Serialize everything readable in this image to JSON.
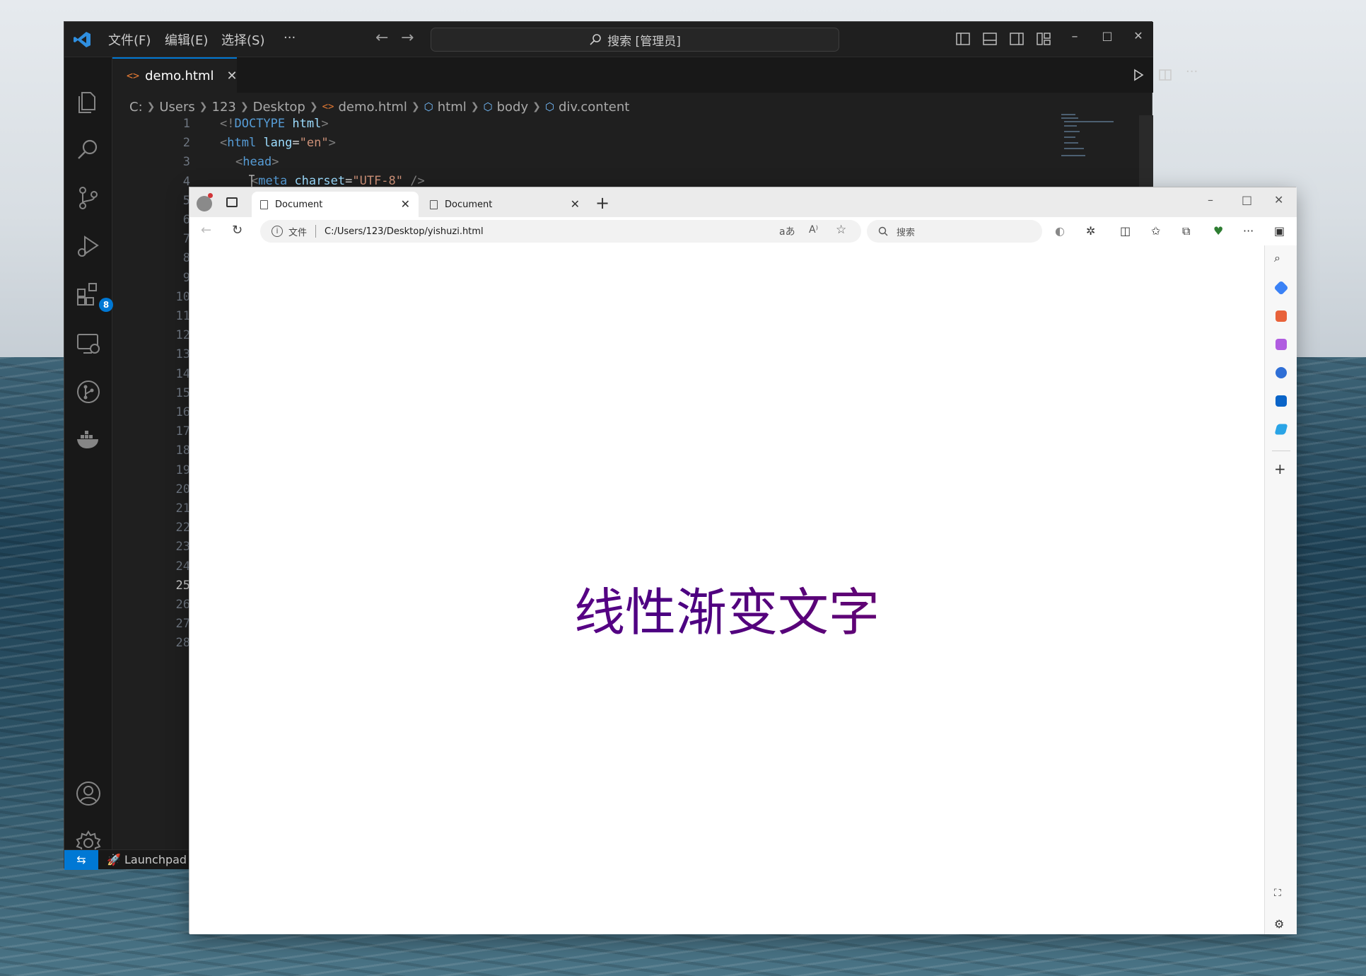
{
  "vscode": {
    "menu": [
      "文件(F)",
      "编辑(E)",
      "选择(S)",
      "···"
    ],
    "search_placeholder": "搜索 [管理员]",
    "tab": {
      "label": "demo.html",
      "close": "✕"
    },
    "breadcrumb": [
      "C:",
      "Users",
      "123",
      "Desktop",
      "demo.html",
      "html",
      "body",
      "div.content"
    ],
    "extensions_badge": "8",
    "status_item": "Launchpad",
    "line_numbers": [
      "1",
      "2",
      "3",
      "4",
      "5",
      "6",
      "7",
      "8",
      "9",
      "10",
      "11",
      "12",
      "13",
      "14",
      "15",
      "16",
      "17",
      "18",
      "19",
      "20",
      "21",
      "22",
      "23",
      "24",
      "25",
      "26",
      "27",
      "28"
    ],
    "active_line": "25",
    "code": {
      "line1": {
        "open": "<!",
        "kw": "DOCTYPE",
        "rest": " html",
        "close": ">"
      },
      "line2": {
        "open": "<",
        "tag": "html",
        "attr": " lang",
        "eq": "=",
        "val": "\"en\"",
        "close": ">"
      },
      "line3": {
        "open": "<",
        "tag": "head",
        "close": ">"
      },
      "line4": {
        "open": "<",
        "tag": "meta",
        "attr": " charset",
        "eq": "=",
        "val": "\"UTF-8\"",
        "close": " />"
      },
      "line27": "<"
    }
  },
  "browser": {
    "tabs": [
      {
        "label": "Document",
        "close": "✕"
      },
      {
        "label": "Document",
        "close": "✕"
      }
    ],
    "new_tab": "+",
    "address": {
      "scheme": "文件",
      "url": "C:/Users/123/Desktop/yishuzi.html"
    },
    "search_placeholder": "搜索",
    "page_text": "线性渐变文字"
  },
  "colors": {
    "vscode_bg": "#1f1f1f",
    "accent": "#0078d4",
    "gradient_start": "#8b008b",
    "gradient_mid": "#4b0082"
  }
}
